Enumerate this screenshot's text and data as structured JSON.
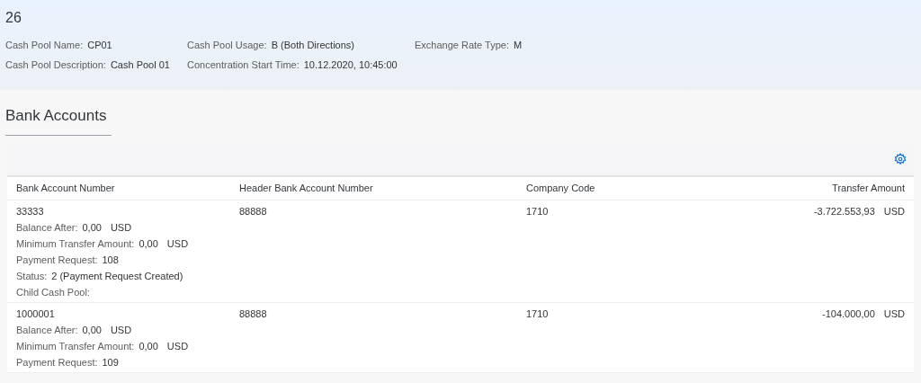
{
  "header": {
    "title": "26",
    "fields": [
      {
        "label": "Cash Pool Name:",
        "value": "CP01"
      },
      {
        "label": "Cash Pool Usage:",
        "value": "B (Both Directions)"
      },
      {
        "label": "Exchange Rate Type:",
        "value": "M"
      },
      {
        "label": "Cash Pool Description:",
        "value": "Cash Pool 01"
      },
      {
        "label": "Concentration Start Time:",
        "value": "10.12.2020, 10:45:00"
      }
    ]
  },
  "section": {
    "title": "Bank Accounts"
  },
  "table": {
    "columns": [
      "Bank Account Number",
      "Header Bank Account Number",
      "Company Code",
      "Transfer Amount"
    ],
    "rows": [
      {
        "bank_account_number": "33333",
        "header_bank_account_number": "88888",
        "company_code": "1710",
        "transfer_amount": "-3.722.553,93",
        "currency": "USD",
        "details": [
          {
            "label": "Balance After:",
            "value": "0,00",
            "unit": "USD"
          },
          {
            "label": "Minimum Transfer Amount:",
            "value": "0,00",
            "unit": "USD"
          },
          {
            "label": "Payment Request:",
            "value": "108"
          },
          {
            "label": "Status:",
            "value": "2 (Payment Request Created)"
          },
          {
            "label": "Child Cash Pool:"
          }
        ]
      },
      {
        "bank_account_number": "1000001",
        "header_bank_account_number": "88888",
        "company_code": "1710",
        "transfer_amount": "-104.000,00",
        "currency": "USD",
        "details": [
          {
            "label": "Balance After:",
            "value": "0,00",
            "unit": "USD"
          },
          {
            "label": "Minimum Transfer Amount:",
            "value": "0,00",
            "unit": "USD"
          },
          {
            "label": "Payment Request:",
            "value": "109"
          }
        ]
      }
    ]
  }
}
